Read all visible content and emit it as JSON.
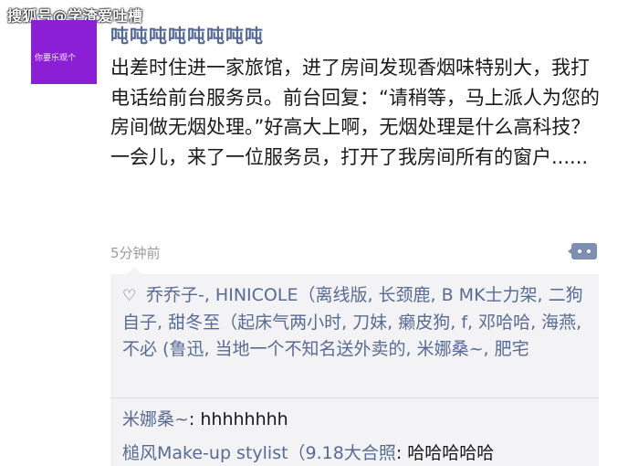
{
  "watermark": "搜狐号@学渣爱吐槽",
  "post": {
    "avatar_text": "你要乐观个",
    "nickname": "吨吨吨吨吨吨吨吨",
    "text": "出差时住进一家旅馆，进了房间发现香烟味特别大，我打电话给前台服务员。前台回复：“请稍等，马上派人为您的房间做无烟处理。”好高大上啊，无烟处理是什么高科技？一会儿，来了一位服务员，打开了我房间所有的窗户......",
    "time": "5分钟前"
  },
  "likes_text": "乔乔子-, HINICOLE（离线版, 长颈鹿, B MK士力架, 二狗自子, 甜冬至（起床气两小时, 刀妹, 癞皮狗, f, 邓哈哈, 海燕, 不必 (鲁迅, 当地一个不知名送外卖的, 米娜桑~, 肥宅",
  "comments": [
    {
      "author": "米娜桑~",
      "text": ": hhhhhhhh"
    },
    {
      "author": "槌风Make-up stylist（9.18大合照",
      "text": ": 哈哈哈哈哈"
    }
  ],
  "icons": {
    "like": "heart-outline-icon",
    "comment": "comment-icon"
  },
  "colors": {
    "link": "#576b95",
    "avatar_bg": "#8b1fd6",
    "panel_bg": "#f3f3f5"
  }
}
